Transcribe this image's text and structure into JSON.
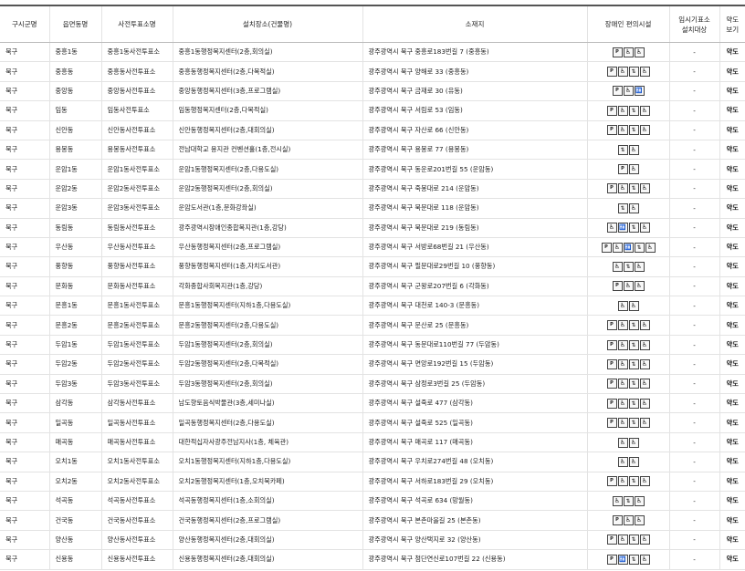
{
  "headers": {
    "district": "구시군명",
    "dong": "읍면동명",
    "station": "사전투표소명",
    "place": "설치장소(건물명)",
    "address": "소재지",
    "facilities": "장애인 편의시설",
    "temp_line1": "임시기표소",
    "temp_line2": "설치대상",
    "map_line1": "약도",
    "map_line2": "보기"
  },
  "icons": {
    "park": {
      "name": "parking-icon",
      "glyph": "P"
    },
    "ramp": {
      "name": "ramp-icon",
      "glyph": "♿"
    },
    "elev": {
      "name": "elevator-icon",
      "glyph": "⇅"
    },
    "wc": {
      "name": "wheelchair-icon",
      "glyph": "♿"
    },
    "toilet": {
      "name": "toilet-icon",
      "glyph": "🚻"
    }
  },
  "rows": [
    {
      "district": "북구",
      "dong": "중흥1동",
      "station": "중흥1동사전투표소",
      "place": "중흥1동행정복지센터(2층,회의실)",
      "address": "광주광역시 북구 중흥로183번길 7 (중흥동)",
      "fac": [
        "park",
        "ramp",
        "wc"
      ],
      "temp": "-",
      "map": "약도"
    },
    {
      "district": "북구",
      "dong": "중흥동",
      "station": "중흥동사전투표소",
      "place": "중흥동행정복지센터(2층,다목적실)",
      "address": "광주광역시 북구 양해로 33 (중흥동)",
      "fac": [
        "park",
        "ramp",
        "elev",
        "wc"
      ],
      "temp": "-",
      "map": "약도"
    },
    {
      "district": "북구",
      "dong": "중앙동",
      "station": "중앙동사전투표소",
      "place": "중앙동행정복지센터(3층,프로그램실)",
      "address": "광주광역시 북구 금재로 30 (유동)",
      "fac": [
        "park",
        "ramp",
        "toilet"
      ],
      "temp": "-",
      "map": "약도"
    },
    {
      "district": "북구",
      "dong": "임동",
      "station": "임동사전투표소",
      "place": "임동행정복지센터(2층,다목적실)",
      "address": "광주광역시 북구 서림로 53 (임동)",
      "fac": [
        "park",
        "ramp",
        "elev",
        "wc"
      ],
      "temp": "-",
      "map": "약도"
    },
    {
      "district": "북구",
      "dong": "신안동",
      "station": "신안동사전투표소",
      "place": "신안동행정복지센터(2층,대회의실)",
      "address": "광주광역시 북구 자산로 66 (신안동)",
      "fac": [
        "park",
        "ramp",
        "elev",
        "wc"
      ],
      "temp": "-",
      "map": "약도"
    },
    {
      "district": "북구",
      "dong": "용봉동",
      "station": "용봉동사전투표소",
      "place": "전남대학교 용지관 컨벤션홀(1층,전시실)",
      "address": "광주광역시 북구 용봉로 77 (용봉동)",
      "fac": [
        "elev",
        "wc"
      ],
      "temp": "-",
      "map": "약도"
    },
    {
      "district": "북구",
      "dong": "운암1동",
      "station": "운암1동사전투표소",
      "place": "운암1동행정복지센터(2층,다용도실)",
      "address": "광주광역시 북구 동운로201번길 55 (운암동)",
      "fac": [
        "park",
        "wc"
      ],
      "temp": "-",
      "map": "약도"
    },
    {
      "district": "북구",
      "dong": "운암2동",
      "station": "운암2동사전투표소",
      "place": "운암2동행정복지센터(2층,회의실)",
      "address": "광주광역시 북구 죽봉대로 214 (운암동)",
      "fac": [
        "park",
        "ramp",
        "elev",
        "wc"
      ],
      "temp": "-",
      "map": "약도"
    },
    {
      "district": "북구",
      "dong": "운암3동",
      "station": "운암3동사전투표소",
      "place": "운암도서관(1층,문화강좌실)",
      "address": "광주광역시 북구 북문대로 118 (운암동)",
      "fac": [
        "elev",
        "wc"
      ],
      "temp": "-",
      "map": "약도"
    },
    {
      "district": "북구",
      "dong": "동림동",
      "station": "동림동사전투표소",
      "place": "광주광역시장애인종합복지관(1층,강당)",
      "address": "광주광역시 북구 북문대로 219 (동림동)",
      "fac": [
        "ramp",
        "toilet",
        "elev",
        "wc"
      ],
      "temp": "-",
      "map": "약도"
    },
    {
      "district": "북구",
      "dong": "우산동",
      "station": "우산동사전투표소",
      "place": "우산동행정복지센터(2층,프로그램실)",
      "address": "광주광역시 북구 서방로68번길 21 (우산동)",
      "fac": [
        "park",
        "ramp",
        "toilet",
        "elev",
        "wc"
      ],
      "temp": "-",
      "map": "약도"
    },
    {
      "district": "북구",
      "dong": "풍향동",
      "station": "풍향동사전투표소",
      "place": "풍향동행정복지센터(1층,자치도서관)",
      "address": "광주광역시 북구 필문대로29번길 10 (풍향동)",
      "fac": [
        "ramp",
        "elev",
        "wc"
      ],
      "temp": "-",
      "map": "약도"
    },
    {
      "district": "북구",
      "dong": "문화동",
      "station": "문화동사전투표소",
      "place": "각화종합사회복지관(1층,강당)",
      "address": "광주광역시 북구 군왕로207번길 6 (각화동)",
      "fac": [
        "park",
        "ramp",
        "wc"
      ],
      "temp": "-",
      "map": "약도"
    },
    {
      "district": "북구",
      "dong": "문흥1동",
      "station": "문흥1동사전투표소",
      "place": "문흥1동행정복지센터(지하1층,다용도실)",
      "address": "광주광역시 북구 대천로 140-3 (문흥동)",
      "fac": [
        "ramp",
        "wc"
      ],
      "temp": "-",
      "map": "약도"
    },
    {
      "district": "북구",
      "dong": "문흥2동",
      "station": "문흥2동사전투표소",
      "place": "문흥2동행정복지센터(2층,다용도실)",
      "address": "광주광역시 북구 문산로 25 (문흥동)",
      "fac": [
        "park",
        "ramp",
        "elev",
        "wc"
      ],
      "temp": "-",
      "map": "약도"
    },
    {
      "district": "북구",
      "dong": "두암1동",
      "station": "두암1동사전투표소",
      "place": "두암1동행정복지센터(2층,회의실)",
      "address": "광주광역시 북구 동문대로110번길 77 (두암동)",
      "fac": [
        "park",
        "ramp",
        "elev",
        "wc"
      ],
      "temp": "-",
      "map": "약도"
    },
    {
      "district": "북구",
      "dong": "두암2동",
      "station": "두암2동사전투표소",
      "place": "두암2동행정복지센터(2층,다목적실)",
      "address": "광주광역시 북구 면앙로192번길 15 (두암동)",
      "fac": [
        "park",
        "ramp",
        "elev",
        "wc"
      ],
      "temp": "-",
      "map": "약도"
    },
    {
      "district": "북구",
      "dong": "두암3동",
      "station": "두암3동사전투표소",
      "place": "두암3동행정복지센터(2층,회의실)",
      "address": "광주광역시 북구 삼정로3번길 25 (두암동)",
      "fac": [
        "park",
        "ramp",
        "elev",
        "wc"
      ],
      "temp": "-",
      "map": "약도"
    },
    {
      "district": "북구",
      "dong": "삼각동",
      "station": "삼각동사전투표소",
      "place": "남도향토음식박물관(3층,세미나실)",
      "address": "광주광역시 북구 설죽로 477 (삼각동)",
      "fac": [
        "park",
        "ramp",
        "elev",
        "wc"
      ],
      "temp": "-",
      "map": "약도"
    },
    {
      "district": "북구",
      "dong": "일곡동",
      "station": "일곡동사전투표소",
      "place": "일곡동행정복지센터(2층,다용도실)",
      "address": "광주광역시 북구 설죽로 525 (일곡동)",
      "fac": [
        "park",
        "ramp",
        "elev",
        "wc"
      ],
      "temp": "-",
      "map": "약도"
    },
    {
      "district": "북구",
      "dong": "매곡동",
      "station": "매곡동사전투표소",
      "place": "대한적십자사광주전남지사(1층, 체육관)",
      "address": "광주광역시 북구 매곡로 117 (매곡동)",
      "fac": [
        "ramp",
        "wc"
      ],
      "temp": "-",
      "map": "약도"
    },
    {
      "district": "북구",
      "dong": "오치1동",
      "station": "오치1동사전투표소",
      "place": "오치1동행정복지센터(지하1층,다용도실)",
      "address": "광주광역시 북구 우치로274번길 48 (오치동)",
      "fac": [
        "ramp",
        "wc"
      ],
      "temp": "-",
      "map": "약도"
    },
    {
      "district": "북구",
      "dong": "오치2동",
      "station": "오치2동사전투표소",
      "place": "오치2동행정복지센터(1층,오치북카페)",
      "address": "광주광역시 북구 서하로183번길 29 (오치동)",
      "fac": [
        "park",
        "ramp",
        "elev",
        "wc"
      ],
      "temp": "-",
      "map": "약도"
    },
    {
      "district": "북구",
      "dong": "석곡동",
      "station": "석곡동사전투표소",
      "place": "석곡동행정복지센터(1층,소회의실)",
      "address": "광주광역시 북구 석곡로 634 (망월동)",
      "fac": [
        "ramp",
        "elev",
        "wc"
      ],
      "temp": "-",
      "map": "약도"
    },
    {
      "district": "북구",
      "dong": "건국동",
      "station": "건국동사전투표소",
      "place": "건국동행정복지센터(2층,프로그램실)",
      "address": "광주광역시 북구 본촌마을길 25 (본촌동)",
      "fac": [
        "park",
        "ramp",
        "wc"
      ],
      "temp": "-",
      "map": "약도"
    },
    {
      "district": "북구",
      "dong": "양산동",
      "station": "양산동사전투표소",
      "place": "양산동행정복지센터(2층,대회의실)",
      "address": "광주광역시 북구 양산택지로 32 (양산동)",
      "fac": [
        "park",
        "ramp",
        "elev",
        "wc"
      ],
      "temp": "-",
      "map": "약도"
    },
    {
      "district": "북구",
      "dong": "신용동",
      "station": "신용동사전투표소",
      "place": "신용동행정복지센터(2층,대회의실)",
      "address": "광주광역시 북구 첨단연신로107번길 22 (신용동)",
      "fac": [
        "park",
        "toilet",
        "elev",
        "wc"
      ],
      "temp": "-",
      "map": "약도"
    }
  ]
}
